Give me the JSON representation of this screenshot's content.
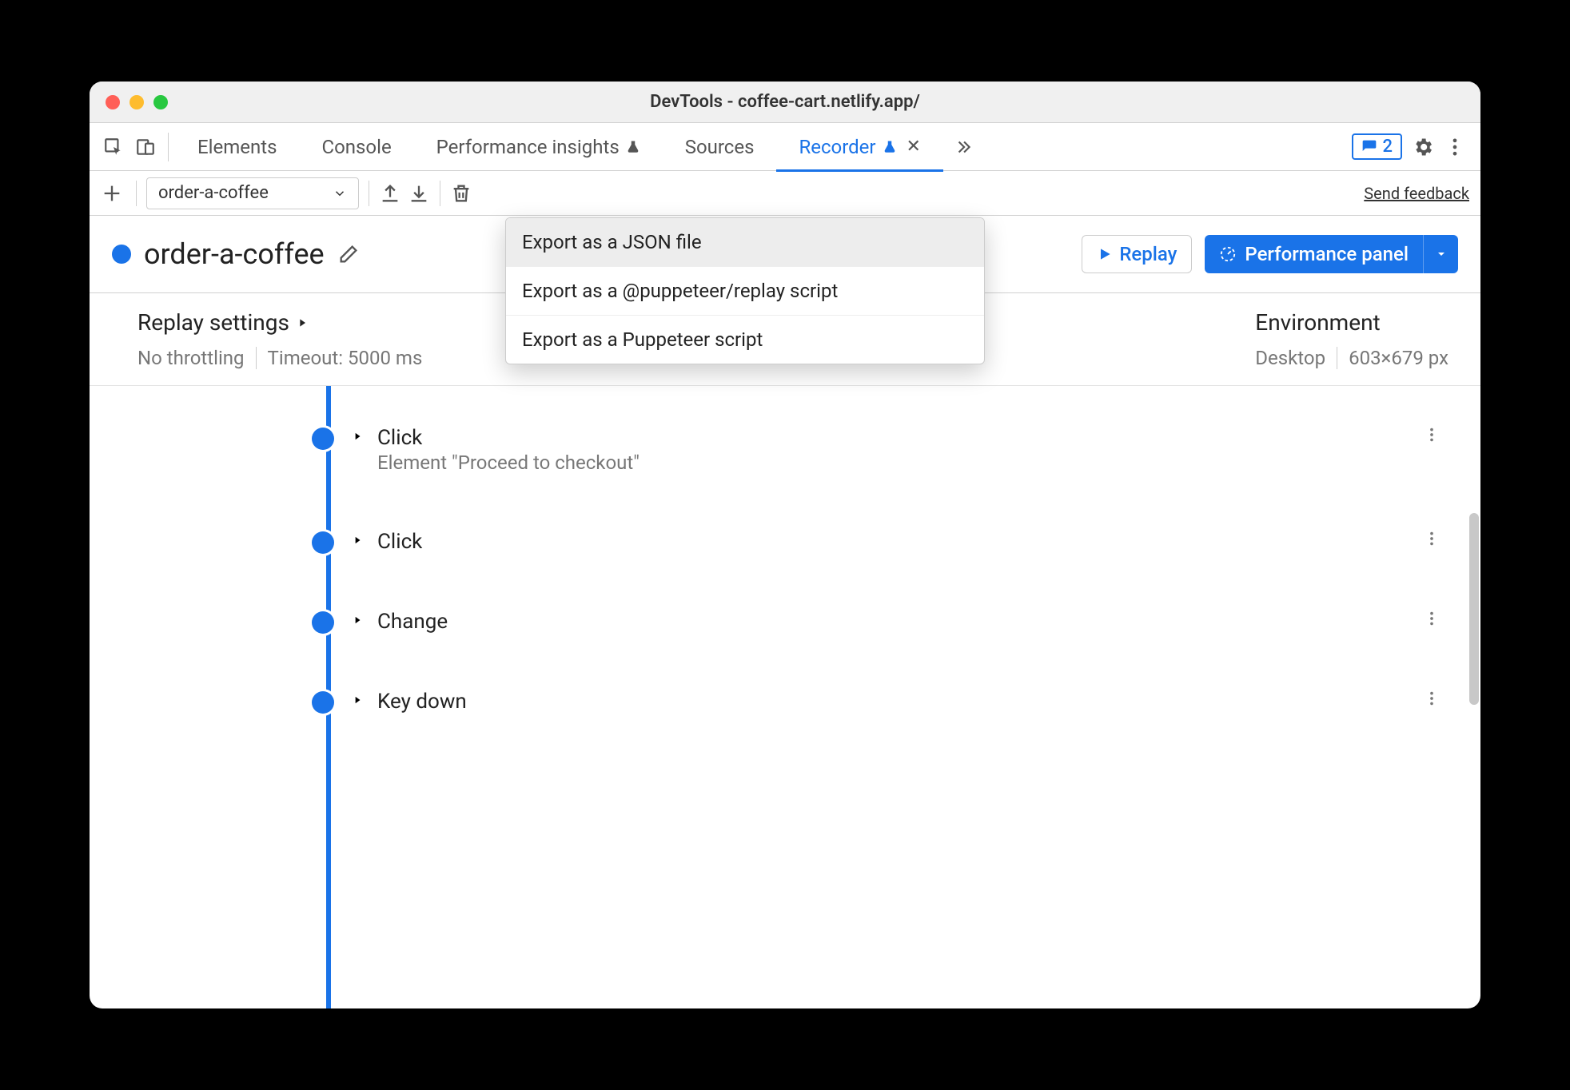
{
  "window": {
    "title": "DevTools - coffee-cart.netlify.app/"
  },
  "tabs": {
    "elements": "Elements",
    "console": "Console",
    "perf_insights": "Performance insights",
    "sources": "Sources",
    "recorder": "Recorder"
  },
  "issues_count": "2",
  "toolbar": {
    "flow_name": "order-a-coffee",
    "feedback": "Send feedback"
  },
  "export_menu": {
    "item1": "Export as a JSON file",
    "item2": "Export as a @puppeteer/replay script",
    "item3": "Export as a Puppeteer script"
  },
  "header": {
    "flow_name": "order-a-coffee",
    "replay": "Replay",
    "perf_panel": "Performance panel"
  },
  "settings": {
    "replay_title": "Replay settings",
    "throttling": "No throttling",
    "timeout": "Timeout: 5000 ms",
    "env_title": "Environment",
    "device": "Desktop",
    "dimensions": "603×679 px"
  },
  "steps": [
    {
      "title": "Click",
      "sub": "Element \"Proceed to checkout\""
    },
    {
      "title": "Click",
      "sub": ""
    },
    {
      "title": "Change",
      "sub": ""
    },
    {
      "title": "Key down",
      "sub": ""
    }
  ]
}
